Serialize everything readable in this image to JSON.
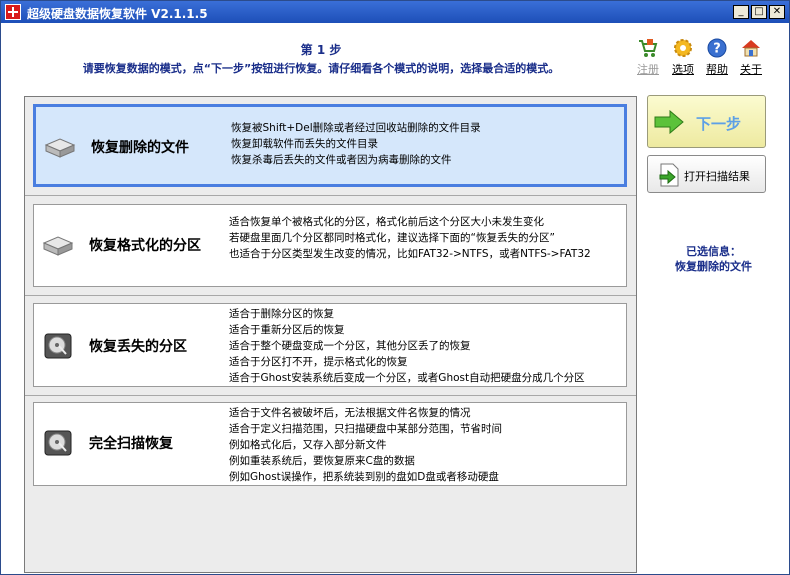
{
  "window": {
    "title": "超级硬盘数据恢复软件 V2.1.1.5",
    "controls": {
      "minimize": "_",
      "maximize": "□",
      "close": "✕"
    }
  },
  "header": {
    "step": "第 1 步",
    "instruction": "请要恢复数据的模式，点“下一步”按钮进行恢复。请仔细看各个模式的说明，选择最合适的模式。"
  },
  "toolbar": {
    "items": [
      {
        "label": "注册",
        "icon": "cart-icon",
        "enabled": false
      },
      {
        "label": "选项",
        "icon": "gear-icon",
        "enabled": true
      },
      {
        "label": "帮助",
        "icon": "help-icon",
        "enabled": true
      },
      {
        "label": "关于",
        "icon": "home-icon",
        "enabled": true
      }
    ]
  },
  "modes": [
    {
      "title": "恢复删除的文件",
      "selected": true,
      "description": [
        "恢复被Shift+Del删除或者经过回收站删除的文件目录",
        "恢复卸载软件而丢失的文件目录",
        "恢复杀毒后丢失的文件或者因为病毒删除的文件"
      ]
    },
    {
      "title": "恢复格式化的分区",
      "selected": false,
      "description": [
        "适合恢复单个被格式化的分区，格式化前后这个分区大小未发生变化",
        "若硬盘里面几个分区都同时格式化，建议选择下面的“恢复丢失的分区”",
        "也适合于分区类型发生改变的情况，比如FAT32->NTFS，或者NTFS->FAT32"
      ]
    },
    {
      "title": "恢复丢失的分区",
      "selected": false,
      "description": [
        "适合于删除分区的恢复",
        "适合于重新分区后的恢复",
        "适合于整个硬盘变成一个分区，其他分区丢了的恢复",
        "适合于分区打不开，提示格式化的恢复",
        "适合于Ghost安装系统后变成一个分区，或者Ghost自动把硬盘分成几个分区"
      ]
    },
    {
      "title": "完全扫描恢复",
      "selected": false,
      "description": [
        "适合于文件名被破坏后，无法根据文件名恢复的情况",
        "适合于定义扫描范围，只扫描硬盘中某部分范围，节省时间",
        "例如格式化后，又存入部分新文件",
        "例如重装系统后，要恢复原来C盘的数据",
        "例如Ghost误操作，把系统装到别的盘如D盘或者移动硬盘"
      ]
    }
  ],
  "actions": {
    "next_label": "下一步",
    "open_scan_label": "打开扫描结果"
  },
  "selected_info": {
    "label": "已选信息：",
    "value": "恢复删除的文件"
  },
  "colors": {
    "titlebar": "#1d4fb8",
    "accent_text": "#1a2e8a",
    "selected_bg": "#d5e7fb",
    "selected_border": "#4a7ee0",
    "next_label": "#5da0e6"
  }
}
